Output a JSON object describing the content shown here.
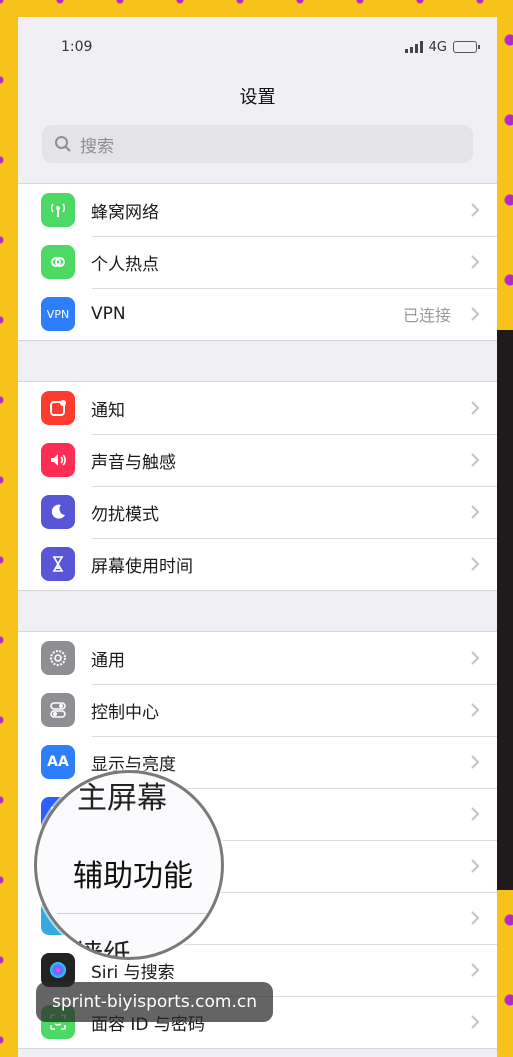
{
  "status": {
    "time": "1:09",
    "network": "4G"
  },
  "header": {
    "title": "设置"
  },
  "search": {
    "placeholder": "搜索"
  },
  "groups": [
    {
      "items": [
        {
          "label": "蜂窝网络",
          "icon": "antenna-icon",
          "color": "#4cd964",
          "value": ""
        },
        {
          "label": "个人热点",
          "icon": "hotspot-icon",
          "color": "#4cd964",
          "value": ""
        },
        {
          "label": "VPN",
          "icon": "vpn-icon",
          "icon_text": "VPN",
          "color": "#2d7ff9",
          "value": "已连接"
        }
      ]
    },
    {
      "items": [
        {
          "label": "通知",
          "icon": "notification-icon",
          "color": "#ff3b30"
        },
        {
          "label": "声音与触感",
          "icon": "speaker-icon",
          "color": "#ff2d55"
        },
        {
          "label": "勿扰模式",
          "icon": "moon-icon",
          "color": "#5856d6"
        },
        {
          "label": "屏幕使用时间",
          "icon": "hourglass-icon",
          "color": "#5856d6"
        }
      ]
    },
    {
      "items": [
        {
          "label": "通用",
          "icon": "gear-icon",
          "color": "#8e8e93"
        },
        {
          "label": "控制中心",
          "icon": "toggle-icon",
          "color": "#8e8e93"
        },
        {
          "label": "显示与亮度",
          "icon": "display-icon",
          "icon_text": "AA",
          "color": "#2d7ff9"
        },
        {
          "label": "",
          "icon": "home-screen-icon",
          "color": "#2d5ff9"
        },
        {
          "label": "",
          "icon": "accessibility-icon",
          "color": "#2d7ff9"
        },
        {
          "label": "",
          "icon": "wallpaper-icon",
          "color": "#35aadc"
        },
        {
          "label": "Siri 与搜索",
          "icon": "siri-icon",
          "color": "#222222"
        },
        {
          "label": "面容 ID 与密码",
          "icon": "faceid-icon",
          "color": "#4cd964"
        }
      ]
    }
  ],
  "magnifier": {
    "top_text": "主屏幕",
    "main_text": "辅助功能",
    "bottom_text": "墙纸"
  },
  "watermark": {
    "text": "sprint-biyisports.com.cn"
  }
}
